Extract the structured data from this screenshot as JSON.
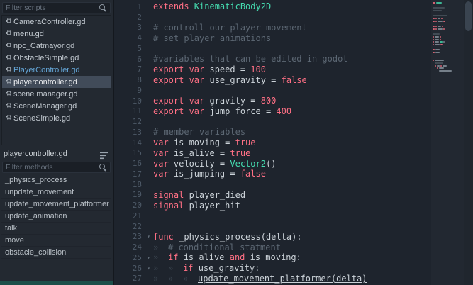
{
  "colors": {
    "kw": "#ff7085",
    "ty": "#45dcb0",
    "cm": "#5c6773",
    "nu": "#ff7085",
    "id": "#ccd3d9",
    "selection": "#414b59",
    "accent_blue": "#64a5d6",
    "editor_bg": "#1e242d",
    "panel_bg": "#232931",
    "teal_bar": "#1d4f4a"
  },
  "sidebar": {
    "filter_scripts_placeholder": "Filter scripts",
    "filter_methods_placeholder": "Filter methods",
    "scripts": [
      {
        "label": "CameraController.gd"
      },
      {
        "label": "menu.gd"
      },
      {
        "label": "npc_Catmayor.gd"
      },
      {
        "label": "ObstacleSimple.gd"
      },
      {
        "label": "PlayerController.gd",
        "state": "remote"
      },
      {
        "label": "playercontroller.gd",
        "state": "selected"
      },
      {
        "label": "scene manager.gd"
      },
      {
        "label": "SceneManager.gd"
      },
      {
        "label": "SceneSimple.gd"
      }
    ],
    "current_script": "playercontroller.gd",
    "methods": [
      "_physics_process",
      "unpdate_movement",
      "update_movement_platformer",
      "update_animation",
      "talk",
      "move",
      "obstacle_collision"
    ]
  },
  "editor": {
    "lines": [
      {
        "n": 1,
        "tokens": [
          [
            "kw",
            "extends "
          ],
          [
            "ty",
            "KinematicBody2D"
          ]
        ]
      },
      {
        "n": 2,
        "tokens": []
      },
      {
        "n": 3,
        "tokens": [
          [
            "cm",
            "# controll our player movement"
          ]
        ]
      },
      {
        "n": 4,
        "tokens": [
          [
            "cm",
            "# set player animations"
          ]
        ]
      },
      {
        "n": 5,
        "tokens": []
      },
      {
        "n": 6,
        "tokens": [
          [
            "cm",
            "#variables that can be edited in godot"
          ]
        ]
      },
      {
        "n": 7,
        "tokens": [
          [
            "kw",
            "export "
          ],
          [
            "kw",
            "var "
          ],
          [
            "id",
            "speed = "
          ],
          [
            "nu",
            "100"
          ]
        ]
      },
      {
        "n": 8,
        "tokens": [
          [
            "kw",
            "export "
          ],
          [
            "kw",
            "var "
          ],
          [
            "id",
            "use_gravity = "
          ],
          [
            "kw",
            "false"
          ]
        ]
      },
      {
        "n": 9,
        "tokens": []
      },
      {
        "n": 10,
        "tokens": [
          [
            "kw",
            "export "
          ],
          [
            "kw",
            "var "
          ],
          [
            "id",
            "gravity = "
          ],
          [
            "nu",
            "800"
          ]
        ]
      },
      {
        "n": 11,
        "tokens": [
          [
            "kw",
            "export "
          ],
          [
            "kw",
            "var "
          ],
          [
            "id",
            "jump_force = "
          ],
          [
            "nu",
            "400"
          ]
        ]
      },
      {
        "n": 12,
        "tokens": []
      },
      {
        "n": 13,
        "tokens": [
          [
            "cm",
            "# member variables"
          ]
        ]
      },
      {
        "n": 14,
        "tokens": [
          [
            "kw",
            "var "
          ],
          [
            "id",
            "is_moving = "
          ],
          [
            "kw",
            "true"
          ]
        ]
      },
      {
        "n": 15,
        "tokens": [
          [
            "kw",
            "var "
          ],
          [
            "id",
            "is_alive = "
          ],
          [
            "kw",
            "true"
          ]
        ]
      },
      {
        "n": 16,
        "tokens": [
          [
            "kw",
            "var "
          ],
          [
            "id",
            "velocity = "
          ],
          [
            "ty",
            "Vector2"
          ],
          [
            "id",
            "()"
          ]
        ]
      },
      {
        "n": 17,
        "tokens": [
          [
            "kw",
            "var "
          ],
          [
            "id",
            "is_jumping = "
          ],
          [
            "kw",
            "false"
          ]
        ]
      },
      {
        "n": 18,
        "tokens": []
      },
      {
        "n": 19,
        "tokens": [
          [
            "kw",
            "signal "
          ],
          [
            "id",
            "player_died"
          ]
        ]
      },
      {
        "n": 20,
        "tokens": [
          [
            "kw",
            "signal "
          ],
          [
            "id",
            "player_hit"
          ]
        ]
      },
      {
        "n": 21,
        "tokens": []
      },
      {
        "n": 22,
        "tokens": []
      },
      {
        "n": 23,
        "fold": true,
        "tokens": [
          [
            "kw",
            "func "
          ],
          [
            "id",
            "_physics_process(delta):"
          ]
        ]
      },
      {
        "n": 24,
        "ind": 1,
        "tokens": [
          [
            "cm",
            "# conditional statment"
          ]
        ]
      },
      {
        "n": 25,
        "fold": true,
        "ind": 1,
        "tokens": [
          [
            "kw",
            "if "
          ],
          [
            "id",
            "is_alive "
          ],
          [
            "kw",
            "and "
          ],
          [
            "id",
            "is_moving:"
          ]
        ]
      },
      {
        "n": 26,
        "fold": true,
        "ind": 2,
        "tokens": [
          [
            "kw",
            "if "
          ],
          [
            "id",
            "use_gravity:"
          ]
        ]
      },
      {
        "n": 27,
        "ind": 3,
        "tokens": [
          [
            "fu",
            "update_movement_platformer(delta)"
          ]
        ]
      }
    ]
  }
}
